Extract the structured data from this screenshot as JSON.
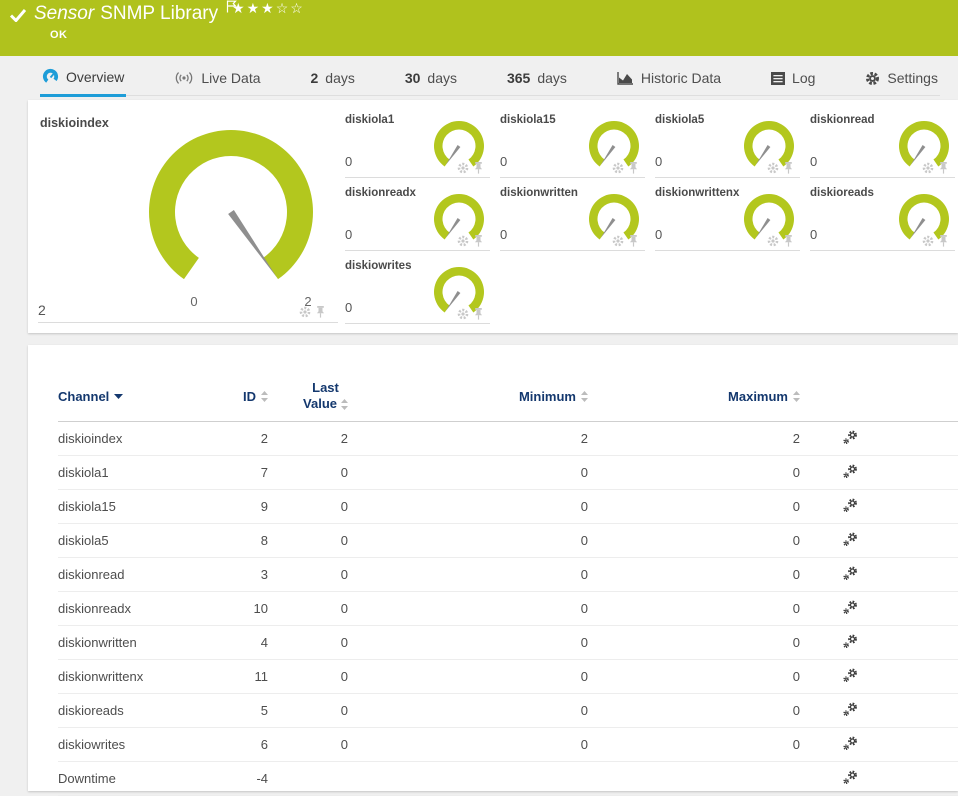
{
  "colors": {
    "brand_green": "#b0c21d",
    "gauge_green": "#b3c71e",
    "needle_gray": "#8f8f8f",
    "accent_blue": "#1e9dd8",
    "header_navy": "#14386e"
  },
  "header": {
    "sensor_kind": "Sensor",
    "sensor_name": "SNMP Library",
    "status": "OK",
    "rating": {
      "filled": 3,
      "total": 5
    }
  },
  "tabs": [
    {
      "label": "Overview",
      "icon": "gauge-icon",
      "active": true
    },
    {
      "label": "Live Data",
      "icon": "live-data-icon"
    },
    {
      "number": "2",
      "label": "days"
    },
    {
      "number": "30",
      "label": "days"
    },
    {
      "number": "365",
      "label": "days"
    },
    {
      "label": "Historic Data",
      "icon": "historic-data-icon"
    },
    {
      "label": "Log",
      "icon": "log-icon"
    },
    {
      "label": "Settings",
      "icon": "settings-gear-icon"
    }
  ],
  "gauges": {
    "main": {
      "name": "diskioindex",
      "value": "2",
      "scale_min": "0",
      "scale_max": "2",
      "fraction": 1
    },
    "tiles": [
      {
        "name": "diskiola1",
        "value": "0",
        "fraction": 0
      },
      {
        "name": "diskiola15",
        "value": "0",
        "fraction": 0
      },
      {
        "name": "diskiola5",
        "value": "0",
        "fraction": 0
      },
      {
        "name": "diskionread",
        "value": "0",
        "fraction": 0
      },
      {
        "name": "diskionreadx",
        "value": "0",
        "fraction": 0
      },
      {
        "name": "diskionwritten",
        "value": "0",
        "fraction": 0
      },
      {
        "name": "diskionwrittenx",
        "value": "0",
        "fraction": 0
      },
      {
        "name": "diskioreads",
        "value": "0",
        "fraction": 0
      },
      {
        "name": "diskiowrites",
        "value": "0",
        "fraction": 0
      }
    ]
  },
  "table": {
    "columns": {
      "channel": "Channel",
      "id": "ID",
      "last_value_line1": "Last",
      "last_value_line2": "Value",
      "minimum": "Minimum",
      "maximum": "Maximum"
    },
    "rows": [
      {
        "channel": "diskioindex",
        "id": "2",
        "last_value": "2",
        "minimum": "2",
        "maximum": "2"
      },
      {
        "channel": "diskiola1",
        "id": "7",
        "last_value": "0",
        "minimum": "0",
        "maximum": "0"
      },
      {
        "channel": "diskiola15",
        "id": "9",
        "last_value": "0",
        "minimum": "0",
        "maximum": "0"
      },
      {
        "channel": "diskiola5",
        "id": "8",
        "last_value": "0",
        "minimum": "0",
        "maximum": "0"
      },
      {
        "channel": "diskionread",
        "id": "3",
        "last_value": "0",
        "minimum": "0",
        "maximum": "0"
      },
      {
        "channel": "diskionreadx",
        "id": "10",
        "last_value": "0",
        "minimum": "0",
        "maximum": "0"
      },
      {
        "channel": "diskionwritten",
        "id": "4",
        "last_value": "0",
        "minimum": "0",
        "maximum": "0"
      },
      {
        "channel": "diskionwrittenx",
        "id": "11",
        "last_value": "0",
        "minimum": "0",
        "maximum": "0"
      },
      {
        "channel": "diskioreads",
        "id": "5",
        "last_value": "0",
        "minimum": "0",
        "maximum": "0"
      },
      {
        "channel": "diskiowrites",
        "id": "6",
        "last_value": "0",
        "minimum": "0",
        "maximum": "0"
      },
      {
        "channel": "Downtime",
        "id": "-4",
        "last_value": "",
        "minimum": "",
        "maximum": ""
      }
    ]
  }
}
